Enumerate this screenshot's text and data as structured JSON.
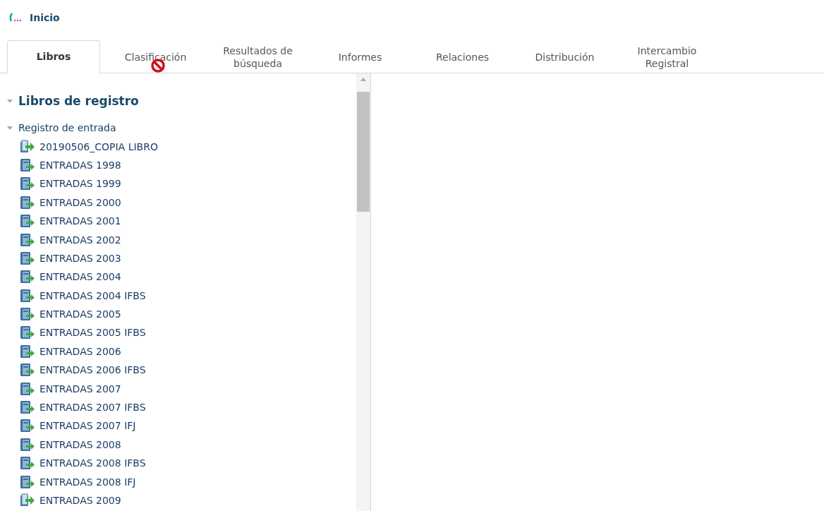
{
  "header": {
    "title": "Inicio"
  },
  "tabs": [
    {
      "label": "Libros",
      "selected": true
    },
    {
      "label": "Clasificación",
      "selected": false
    },
    {
      "label": "Resultados de búsqueda",
      "selected": false
    },
    {
      "label": "Informes",
      "selected": false
    },
    {
      "label": "Relaciones",
      "selected": false
    },
    {
      "label": "Distribución",
      "selected": false
    },
    {
      "label": "Intercambio Registral",
      "selected": false
    }
  ],
  "tree": {
    "label": "Libros de registro",
    "expanded": true,
    "children": [
      {
        "label": "Registro de entrada",
        "expanded": true,
        "children": [
          {
            "label": "20190506_COPIA LIBRO",
            "kind": "copy"
          },
          {
            "label": "ENTRADAS 1998",
            "kind": "book"
          },
          {
            "label": "ENTRADAS 1999",
            "kind": "book"
          },
          {
            "label": "ENTRADAS 2000",
            "kind": "book"
          },
          {
            "label": "ENTRADAS 2001",
            "kind": "book"
          },
          {
            "label": "ENTRADAS 2002",
            "kind": "book"
          },
          {
            "label": "ENTRADAS 2003",
            "kind": "book"
          },
          {
            "label": "ENTRADAS 2004",
            "kind": "book"
          },
          {
            "label": "ENTRADAS 2004 IFBS",
            "kind": "book"
          },
          {
            "label": "ENTRADAS 2005",
            "kind": "book"
          },
          {
            "label": "ENTRADAS 2005 IFBS",
            "kind": "book"
          },
          {
            "label": "ENTRADAS 2006",
            "kind": "book"
          },
          {
            "label": "ENTRADAS 2006 IFBS",
            "kind": "book"
          },
          {
            "label": "ENTRADAS 2007",
            "kind": "book"
          },
          {
            "label": "ENTRADAS 2007 IFBS",
            "kind": "book"
          },
          {
            "label": "ENTRADAS 2007 IFJ",
            "kind": "book"
          },
          {
            "label": "ENTRADAS 2008",
            "kind": "book"
          },
          {
            "label": "ENTRADAS 2008 IFBS",
            "kind": "book"
          },
          {
            "label": "ENTRADAS 2008 IFJ",
            "kind": "book"
          },
          {
            "label": "ENTRADAS 2009",
            "kind": "copy"
          }
        ]
      }
    ]
  }
}
